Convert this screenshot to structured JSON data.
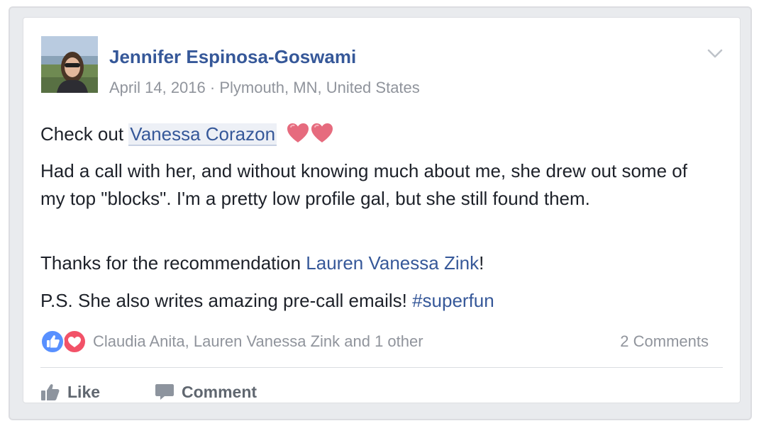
{
  "post": {
    "author": "Jennifer Espinosa-Goswami",
    "date": "April 14, 2016",
    "separator": " · ",
    "location": "Plymouth, MN, United States",
    "line1_prefix": "Check out ",
    "mention": "Vanessa Corazon",
    "heart_icons": [
      "heart-icon",
      "heart-icon"
    ],
    "paragraph2": "Had a call with her, and without knowing much about me, she drew out some of my top \"blocks\". I'm a pretty low profile gal, but she still found them.",
    "line3_prefix": "Thanks for the recommendation ",
    "line3_link": "Lauren Vanessa Zink",
    "line3_suffix": "!",
    "line4_prefix": "P.S. She also writes amazing pre-call emails! ",
    "hashtag": "#superfun"
  },
  "reactions": {
    "icons": [
      "like-reaction-icon",
      "love-reaction-icon"
    ],
    "names": "Claudia Anita, Lauren Vanessa Zink and 1 other",
    "comments": "2 Comments"
  },
  "actions": {
    "like": "Like",
    "comment": "Comment"
  },
  "colors": {
    "link": "#365899",
    "meta": "#90949c",
    "text": "#1d2129",
    "like_blue": "#5890ff",
    "love_red": "#f25268",
    "heart_pink": "#e66b7e"
  }
}
